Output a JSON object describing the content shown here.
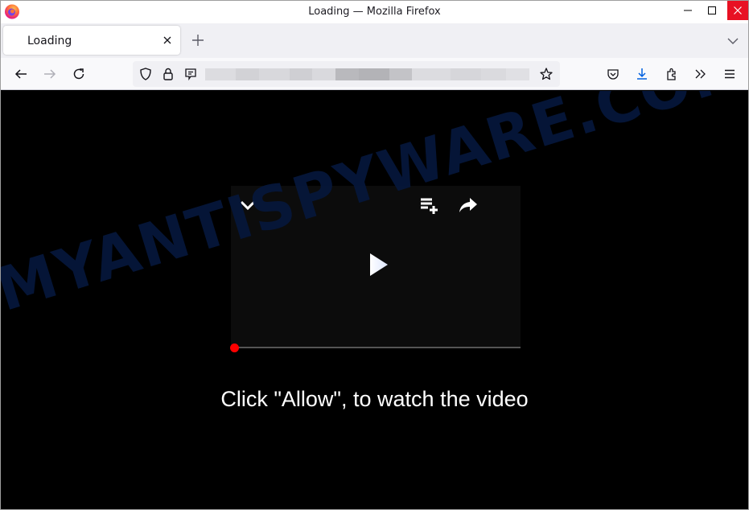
{
  "window": {
    "title": "Loading — Mozilla Firefox",
    "controls": [
      "minimize-icon",
      "maximize-icon",
      "close-icon"
    ],
    "close_color": "#e81123"
  },
  "tabs": [
    {
      "label": "Loading",
      "active": true,
      "close_icon": "close-icon"
    }
  ],
  "tabbar": {
    "new_tab_icon": "plus-icon",
    "list_all_tabs_icon": "chevron-down-icon"
  },
  "navbar": {
    "back_icon": "arrow-left-icon",
    "forward_icon": "arrow-right-icon",
    "reload_icon": "reload-icon",
    "tracking_protection_icon": "shield-icon",
    "site_security_icon": "lock-icon",
    "permissions_icon": "notification-icon",
    "url": "",
    "url_obscured": true,
    "bookmark_icon": "star-icon",
    "toolbar_icons": [
      "pocket-icon",
      "download-icon",
      "extensions-icon",
      "overflow-icon",
      "menu-icon"
    ],
    "download_color": "#0060df"
  },
  "page": {
    "player": {
      "collapse_icon": "chevron-down-icon",
      "queue_icon": "playlist-add-icon",
      "share_icon": "share-icon",
      "play_icon": "play-icon",
      "progress": 0,
      "progress_color": "#ff0000"
    },
    "message": "Click \"Allow\", to watch the video",
    "watermark": "MYANTISPYWARE.COM",
    "watermark_color": "#06173a"
  }
}
